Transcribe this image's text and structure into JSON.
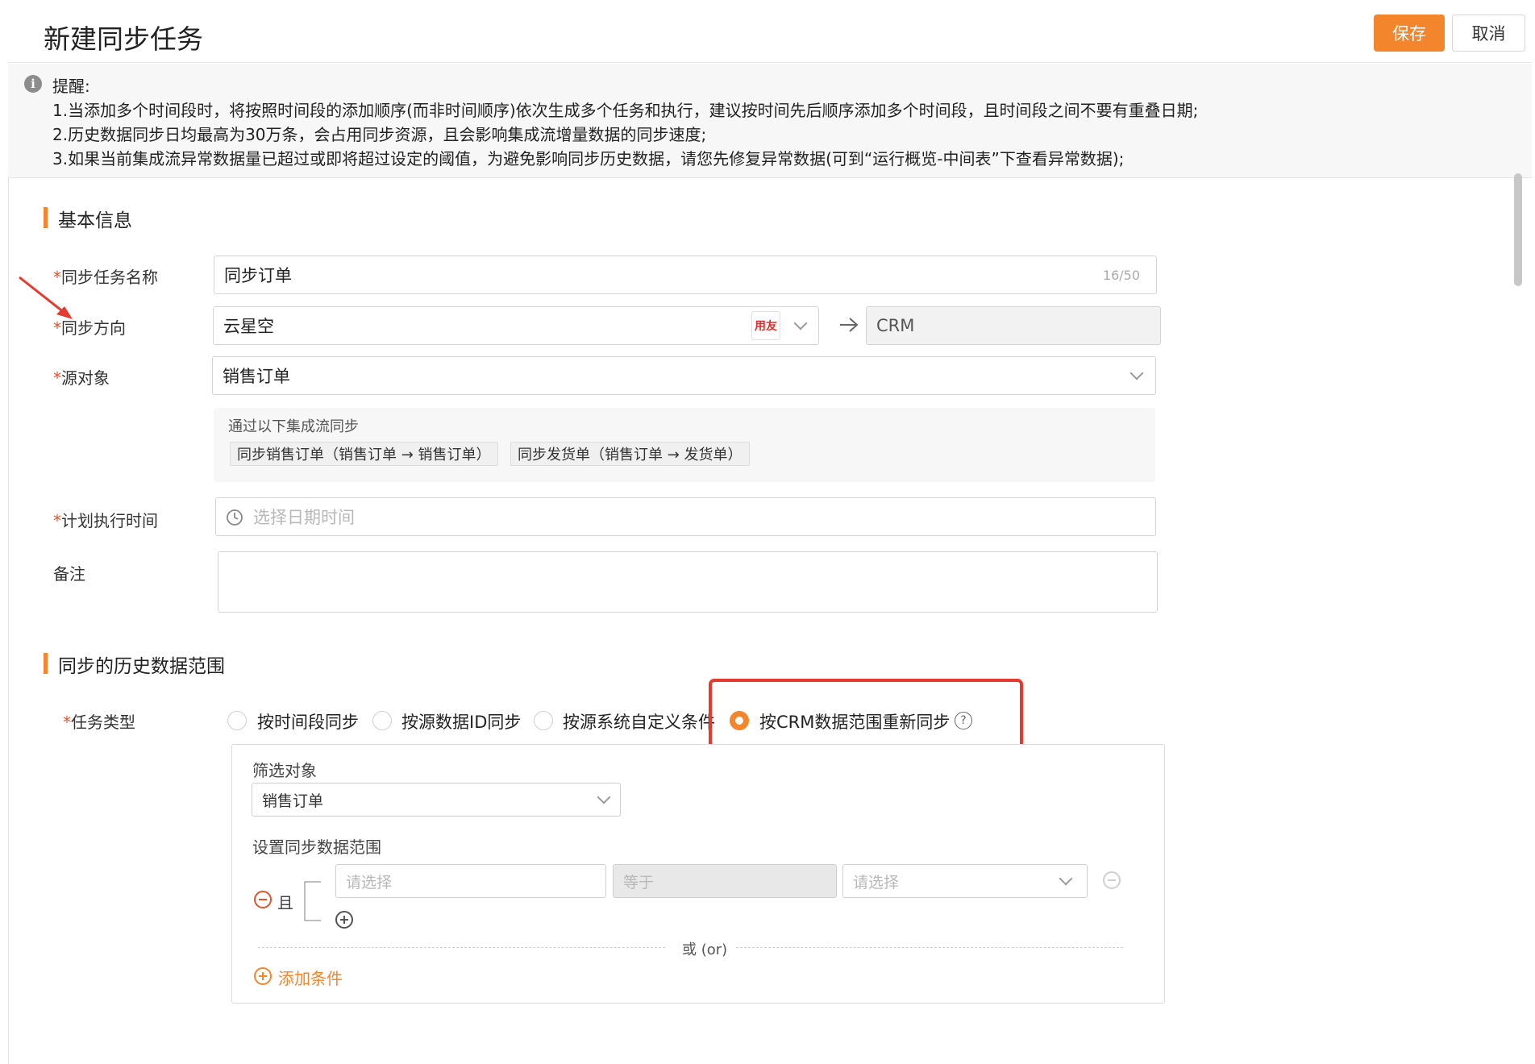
{
  "header": {
    "title": "新建同步任务",
    "save_label": "保存",
    "cancel_label": "取消"
  },
  "notice": {
    "title": "提醒:",
    "lines": [
      "1.当添加多个时间段时，将按照时间段的添加顺序(而非时间顺序)依次生成多个任务和执行，建议按时间先后顺序添加多个时间段，且时间段之间不要有重叠日期;",
      "2.历史数据同步日均最高为30万条，会占用同步资源，且会影响集成流增量数据的同步速度;",
      "3.如果当前集成流异常数据量已超过或即将超过设定的阈值，为避免影响同步历史数据，请您先修复异常数据(可到“运行概览-中间表”下查看异常数据);"
    ]
  },
  "basic": {
    "section_title": "基本信息",
    "name_label": "同步任务名称",
    "name_value": "同步订单",
    "name_counter": "16/50",
    "direction_label": "同步方向",
    "direction_source": "云星空",
    "direction_logo": "用友",
    "direction_target": "CRM",
    "source_label": "源对象",
    "source_value": "销售订单",
    "flow_title": "通过以下集成流同步",
    "flow_tags": [
      "同步销售订单（销售订单 → 销售订单）",
      "同步发货单（销售订单 → 发货单）"
    ],
    "schedule_label": "计划执行时间",
    "schedule_placeholder": "选择日期时间",
    "remark_label": "备注",
    "required_mark": "*"
  },
  "history": {
    "section_title": "同步的历史数据范围",
    "task_type_label": "任务类型",
    "options": [
      "按时间段同步",
      "按源数据ID同步",
      "按源系统自定义条件",
      "按CRM数据范围重新同步"
    ],
    "selected_option": "按CRM数据范围重新同步",
    "help_glyph": "?",
    "filter_object_label": "筛选对象",
    "filter_object_value": "销售订单",
    "range_label": "设置同步数据范围",
    "and_label": "且",
    "field_placeholder": "请选择",
    "operator_value": "等于",
    "value_placeholder": "请选择",
    "or_label": "或 (or)",
    "add_condition_label": "添加条件"
  },
  "colors": {
    "accent": "#f3852d",
    "required": "#e0532d",
    "highlight": "#e53a2d"
  },
  "icons": [
    "info-icon",
    "chevron-down-icon",
    "arrow-right-icon",
    "clock-icon",
    "help-icon",
    "minus-circle-icon",
    "plus-circle-icon"
  ]
}
